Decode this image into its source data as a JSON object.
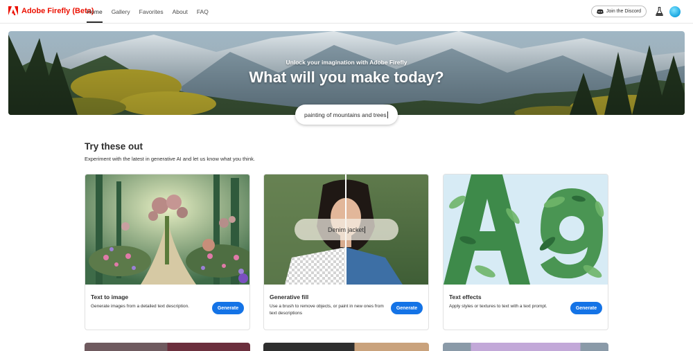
{
  "brand": {
    "name": "Adobe Firefly (Beta)",
    "color": "#eb1000"
  },
  "nav": {
    "links": [
      "Home",
      "Gallery",
      "Favorites",
      "About",
      "FAQ"
    ],
    "active": "Home",
    "discord_label": "Join the Discord"
  },
  "hero": {
    "subtitle": "Unlock your imagination with Adobe Firefly",
    "title": "What will you make today?",
    "prompt_value": "painting of mountains and trees"
  },
  "section": {
    "title": "Try these out",
    "description": "Experiment with the latest in generative AI and let us know what you think."
  },
  "cards": [
    {
      "title": "Text to image",
      "description": "Generate images from a detailed text description.",
      "button": "Generate"
    },
    {
      "title": "Generative fill",
      "description": "Use a brush to remove objects, or paint in new ones from text descriptions",
      "button": "Generate",
      "overlay_text": "Denim jacket"
    },
    {
      "title": "Text effects",
      "description": "Apply styles or textures to text with a text prompt.",
      "button": "Generate"
    }
  ],
  "colors": {
    "accent": "#1473e6",
    "text": "#2c2c2c"
  }
}
